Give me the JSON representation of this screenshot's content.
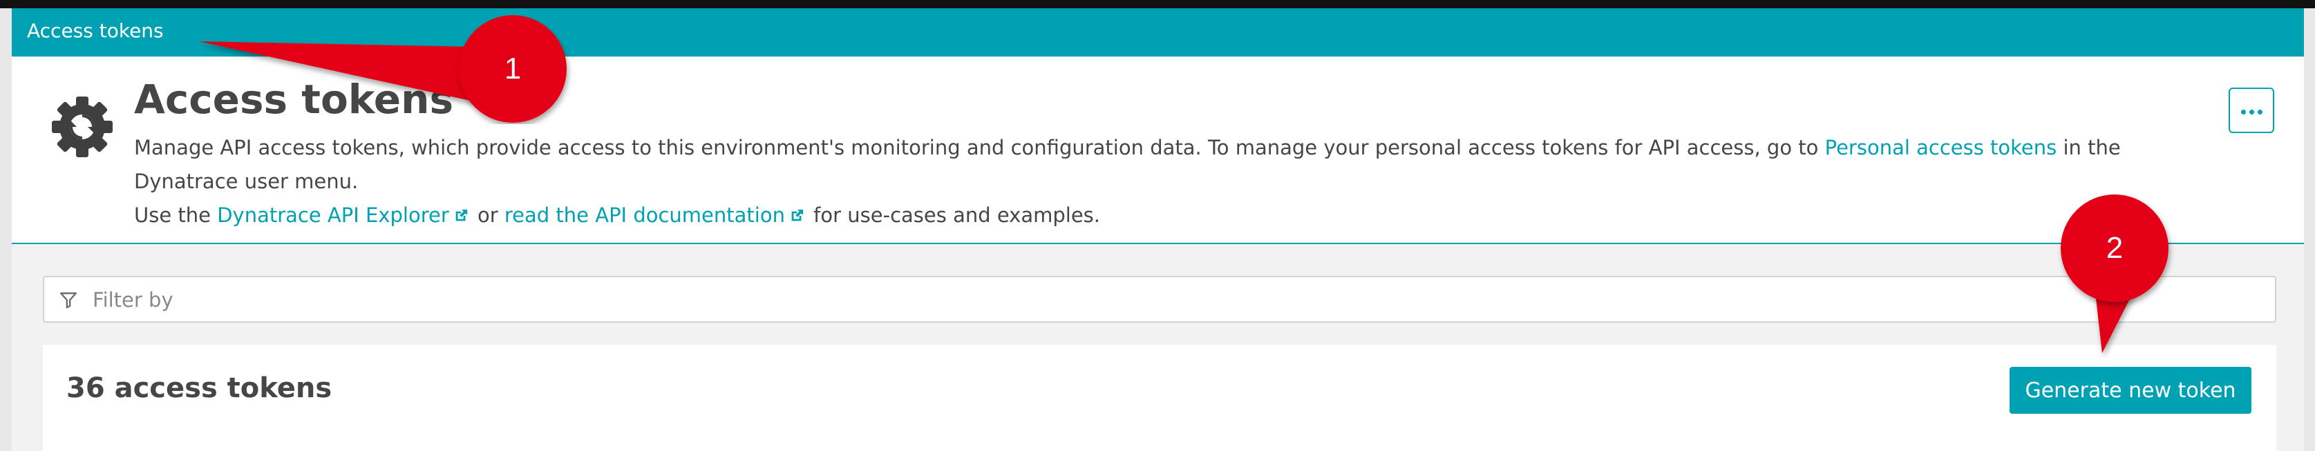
{
  "titlebar": {
    "title": "Access tokens"
  },
  "header": {
    "title": "Access tokens",
    "desc_line1_pre": "Manage API access tokens, which provide access to this environment's monitoring and configuration data. To manage your personal access tokens for API access, go to ",
    "personal_tokens_link": "Personal access tokens",
    "desc_line1_post": " in the Dynatrace user menu.",
    "use_the": "Use the ",
    "api_explorer_link": "Dynatrace API Explorer",
    "or": " or ",
    "api_docs_link": "read the API documentation",
    "desc_line2_post": " for use-cases and examples.",
    "more_button_icon": "ellipsis-icon"
  },
  "filter": {
    "placeholder": "Filter by",
    "icon": "filter-icon"
  },
  "list": {
    "count_label": "36 access tokens",
    "generate_button": "Generate new token"
  },
  "annotations": [
    {
      "label": "1"
    },
    {
      "label": "2"
    }
  ],
  "colors": {
    "accent": "#00a1b2",
    "annotation": "#e30613",
    "text": "#454646"
  }
}
